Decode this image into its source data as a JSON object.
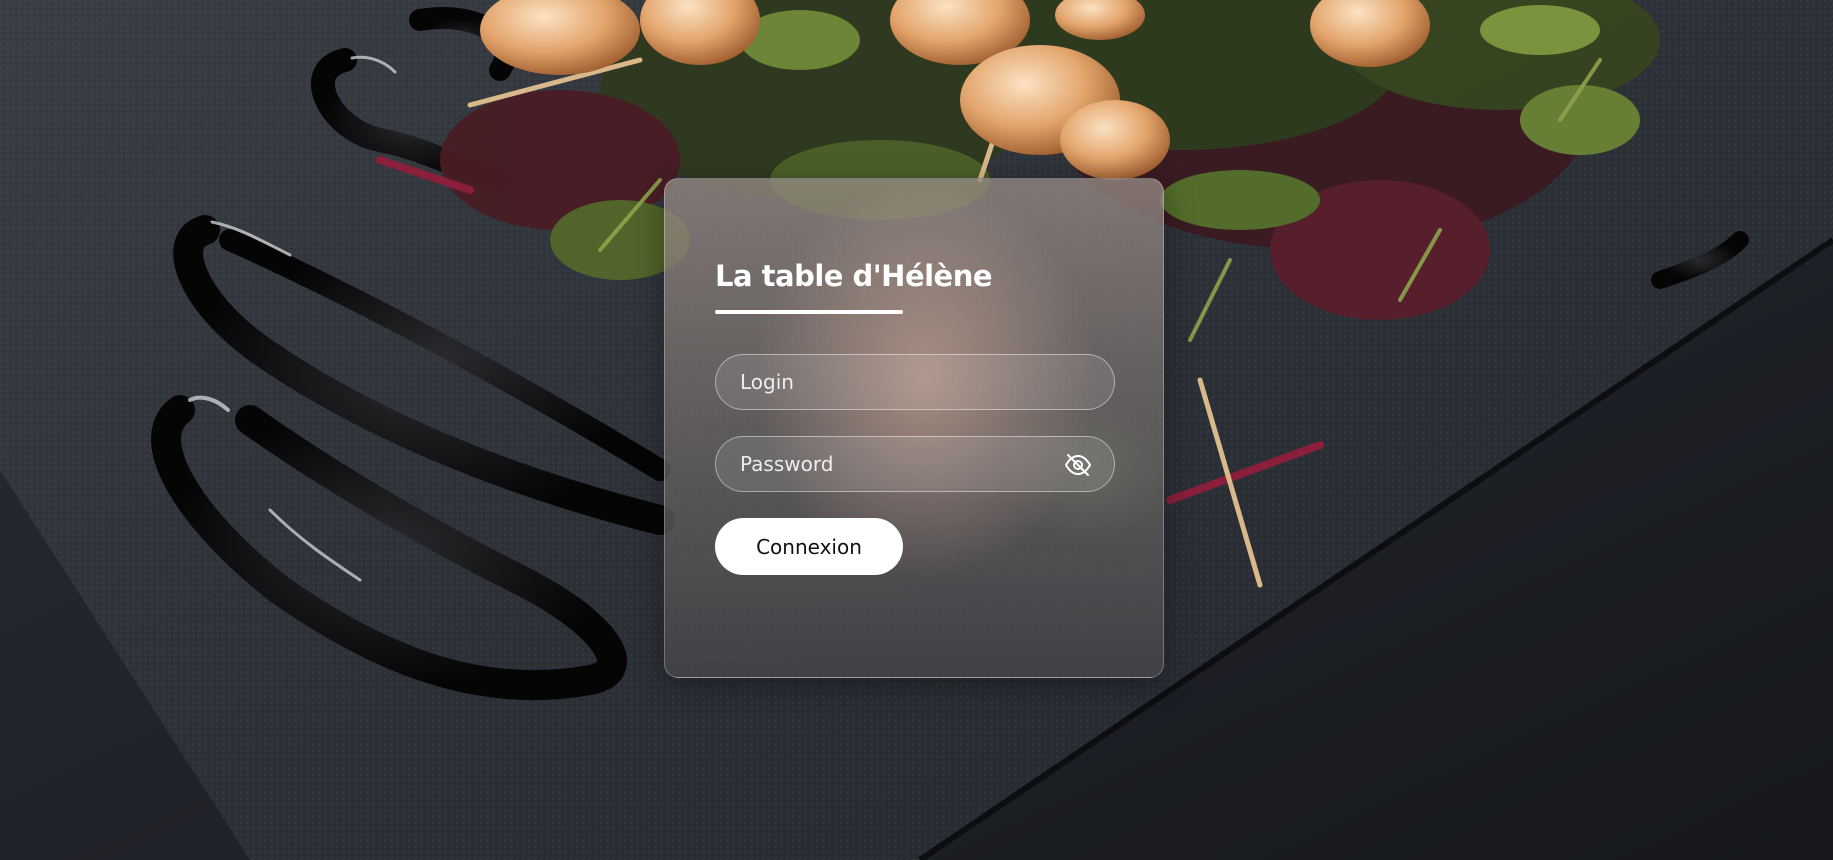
{
  "brand": {
    "title": "La table d'Hélène"
  },
  "login_form": {
    "login_placeholder": "Login",
    "password_placeholder": "Password",
    "password_toggle_icon": "eye-off-icon",
    "submit_label": "Connexion"
  },
  "colors": {
    "card_border": "#ffffff",
    "button_background": "#ffffff",
    "button_text": "#111111",
    "title_text": "#ffffff"
  }
}
